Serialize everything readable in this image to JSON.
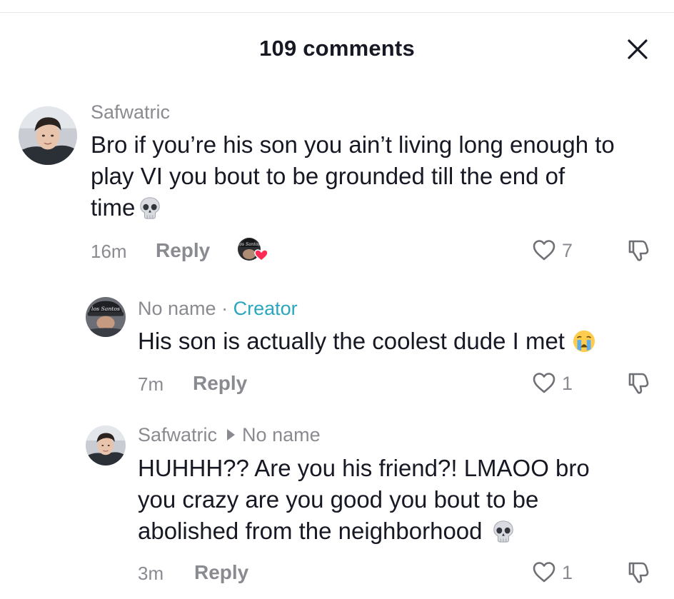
{
  "header": {
    "title": "109 comments",
    "close_icon": "close-icon"
  },
  "comments": [
    {
      "username": "Safwatric",
      "text": "Bro if you’re his son you ain’t living long enough to play VI you bout to be grounded till the end of time",
      "text_lines": [
        "Bro if you’re his son you ain’t living long enough to",
        "play VI you bout to be grounded till the end of",
        "time"
      ],
      "emoji": "skull-emoji",
      "time": "16m",
      "reply_label": "Reply",
      "creator_liked": true,
      "likes": "7"
    },
    {
      "username": "No name",
      "separator": "·",
      "badge": "Creator",
      "text": "His son is actually the coolest dude I met",
      "emoji": "crying-face-emoji",
      "time": "7m",
      "reply_label": "Reply",
      "likes": "1"
    },
    {
      "username": "Safwatric",
      "reply_to": "No name",
      "text": "HUHHH?? Are you his friend?! LMAOO bro you crazy are you good you bout to be abolished from the neighborhood",
      "text_lines": [
        "HUHHH?? Are you his friend?! LMAOO bro",
        "you crazy are you good you bout to be",
        "abolished from the neighborhood"
      ],
      "emoji": "skull-emoji",
      "time": "3m",
      "reply_label": "Reply",
      "likes": "1"
    }
  ],
  "colors": {
    "muted": "#8a8b91",
    "text": "#161823",
    "creator": "#2aa6bf",
    "heart": "#fe2c55"
  }
}
